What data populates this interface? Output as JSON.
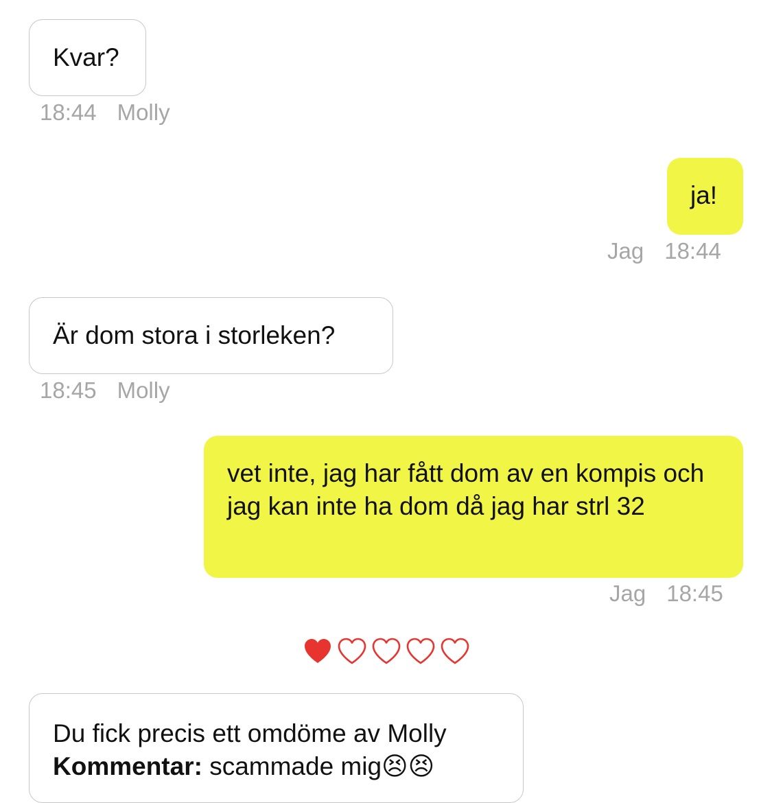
{
  "messages": [
    {
      "from": "Molly",
      "direction": "incoming",
      "text": "Kvar?",
      "time": "18:44",
      "sender_label": "Molly"
    },
    {
      "from": "Jag",
      "direction": "outgoing",
      "text": "ja!",
      "time": "18:44",
      "sender_label": "Jag"
    },
    {
      "from": "Molly",
      "direction": "incoming",
      "text": "Är dom stora i storleken?",
      "time": "18:45",
      "sender_label": "Molly"
    },
    {
      "from": "Jag",
      "direction": "outgoing",
      "text": "vet inte, jag har fått dom av en kompis och jag kan inte ha dom då jag har strl 32",
      "time": "18:45",
      "sender_label": "Jag"
    }
  ],
  "rating": {
    "value": 1,
    "max": 5,
    "filled_color": "#e8342f",
    "outline_color": "#e8342f",
    "icon": "heart-icon"
  },
  "review": {
    "headline": "Du fick precis ett omdöme av Molly",
    "comment_label": "Kommentar:",
    "comment_text": " scammade mig😣😣"
  },
  "colors": {
    "outgoing_bubble": "#f1f545",
    "incoming_border": "#c8c8c8",
    "meta_text": "#a6a6a6"
  }
}
